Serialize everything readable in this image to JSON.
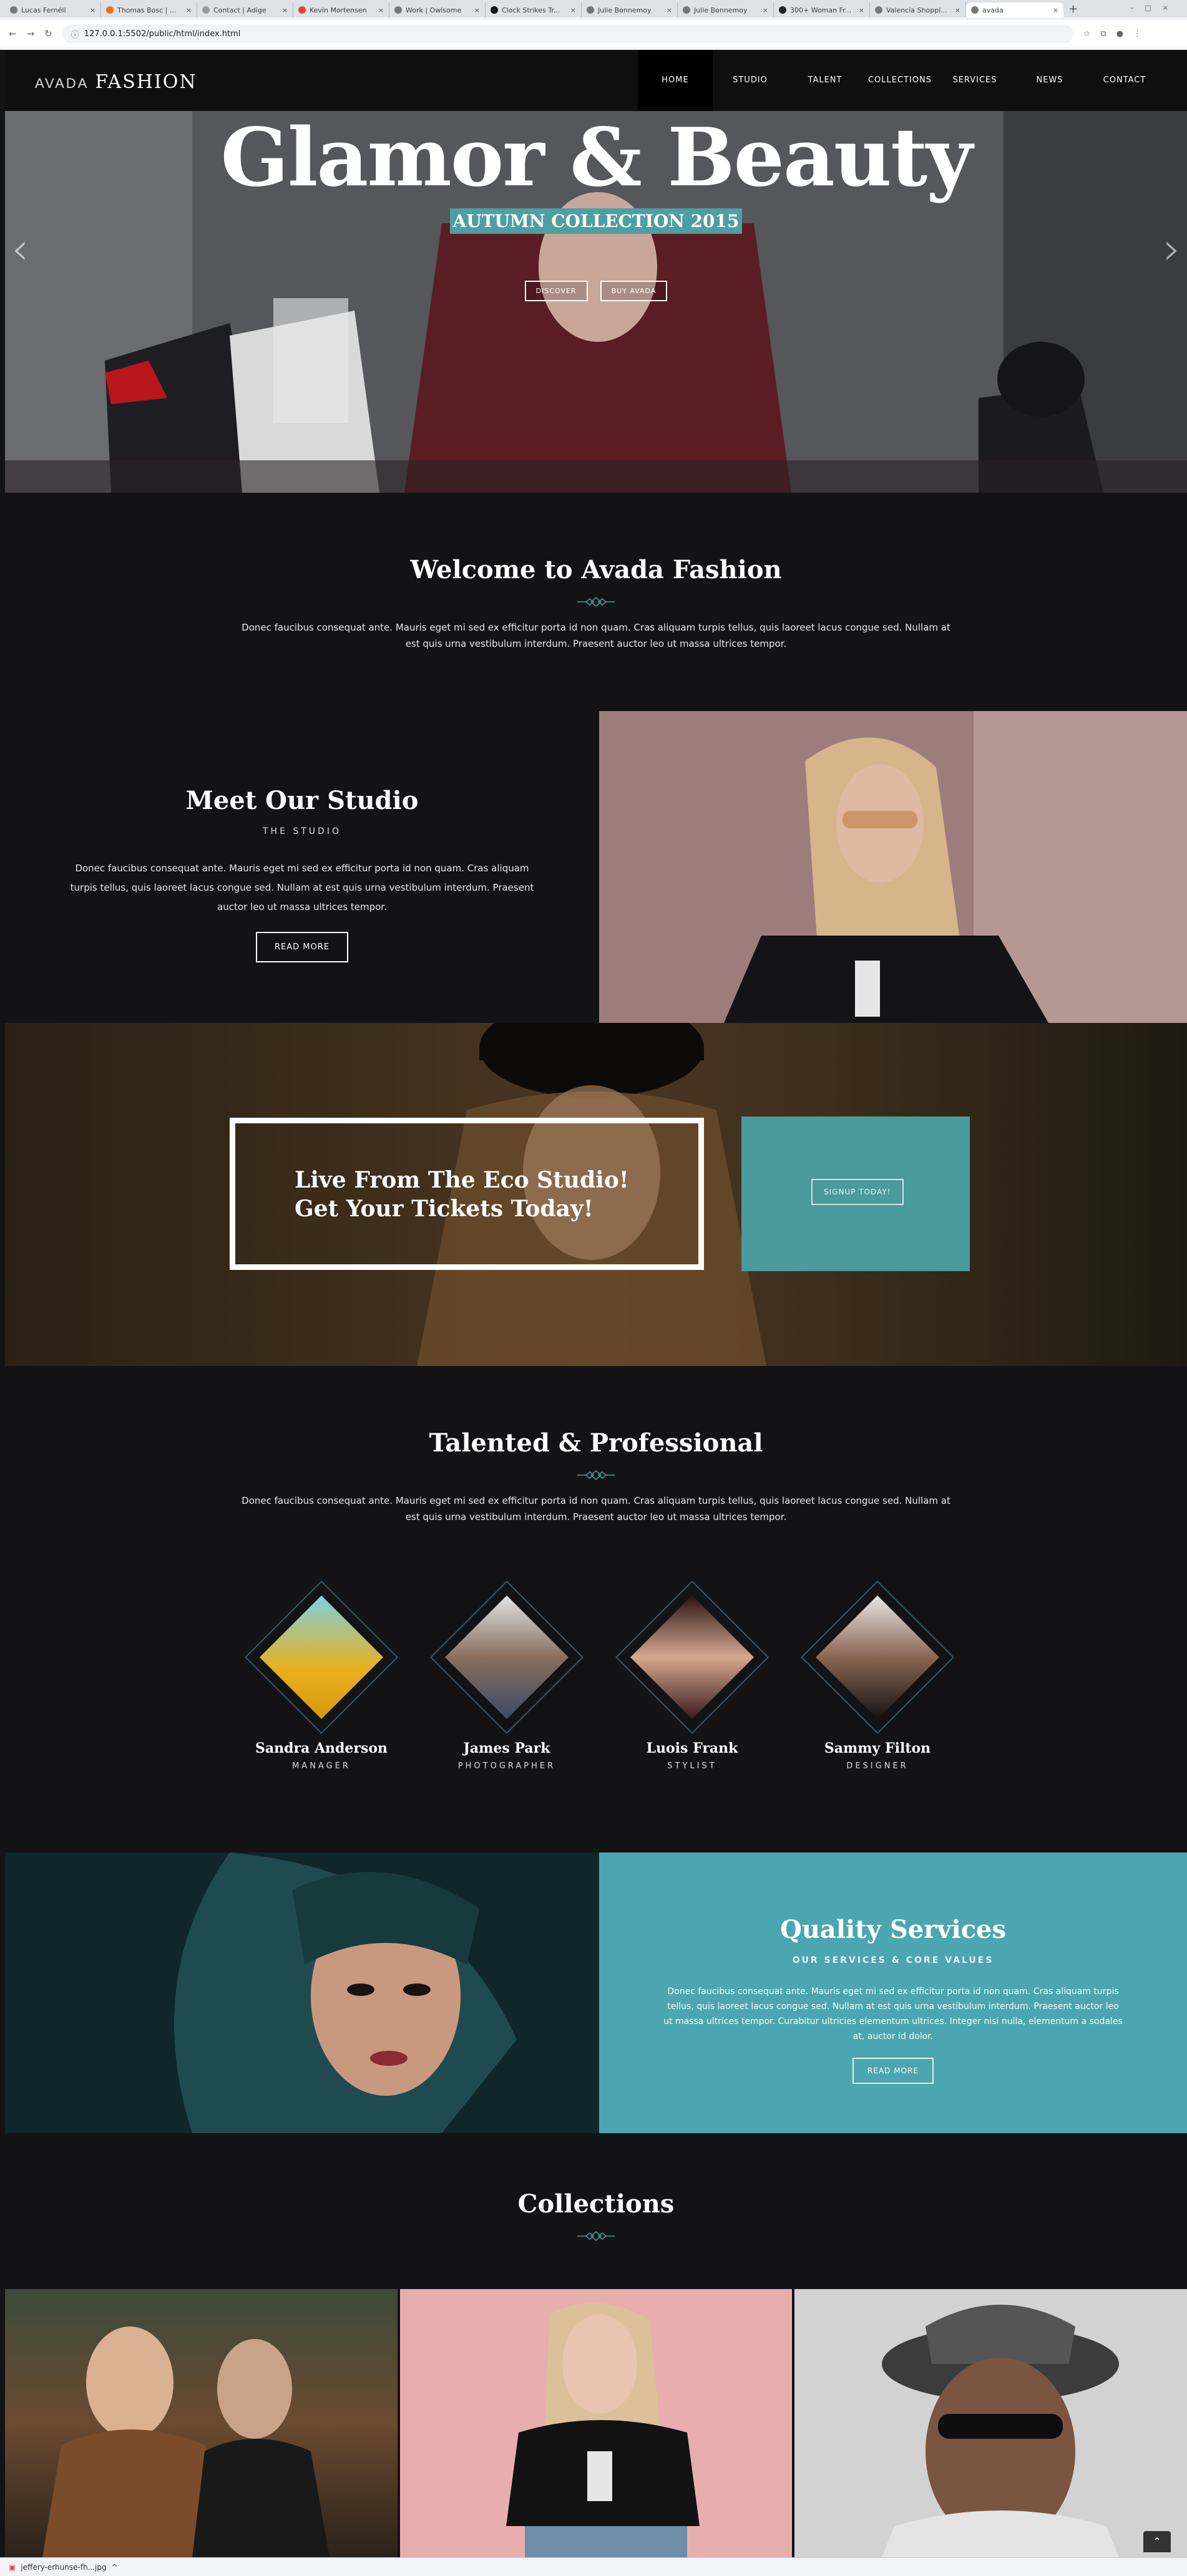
{
  "browser": {
    "tabs": [
      {
        "label": "Lucas Fernéll"
      },
      {
        "label": "Thomas Bosc | ..."
      },
      {
        "label": "Contact | Adige"
      },
      {
        "label": "Kevin Mortensen"
      },
      {
        "label": "Work | Owlsome"
      },
      {
        "label": "Clock Strikes Tr..."
      },
      {
        "label": "Julie Bonnemoy"
      },
      {
        "label": "Julie Bonnemoy"
      },
      {
        "label": "300+ Woman Fr..."
      },
      {
        "label": "Valencia Shoppi..."
      },
      {
        "label": "avada"
      }
    ],
    "url": "127.0.0.1:5502/public/html/index.html",
    "download_file": "jeffery-erhunse-fh...jpg"
  },
  "site": {
    "logo": {
      "prefix": "AVADA",
      "name": "FASHION"
    },
    "menu": [
      "HOME",
      "STUDIO",
      "TALENT",
      "COLLECTIONS",
      "SERVICES",
      "NEWS",
      "CONTACT"
    ],
    "hero": {
      "title": "Glamor & Beauty",
      "subtitle": "AUTUMN COLLECTION 2015",
      "btn_discover": "DISCOVER",
      "btn_buy": "BUY AVADA"
    },
    "welcome": {
      "title": "Welcome to Avada Fashion",
      "text": "Donec faucibus consequat ante. Mauris eget mi sed ex efficitur porta id non quam. Cras aliquam turpis tellus, quis laoreet lacus congue sed. Nullam at est quis urna vestibulum interdum. Praesent auctor leo ut massa ultrices tempor."
    },
    "studio": {
      "title": "Meet Our Studio",
      "tag": "THE STUDIO",
      "text": "Donec faucibus consequat ante. Mauris eget mi sed ex efficitur porta id non quam. Cras aliquam turpis tellus, quis laoreet lacus congue sed. Nullam at est quis urna vestibulum interdum. Praesent auctor leo ut massa ultrices tempor.",
      "button": "READ MORE"
    },
    "eco": {
      "title": "Live From The Eco Studio! Get Your Tickets Today!",
      "button": "SIGNUP TODAY!"
    },
    "talent": {
      "title": "Talented & Professional",
      "text": "Donec faucibus consequat ante. Mauris eget mi sed ex efficitur porta id non quam. Cras aliquam turpis tellus, quis laoreet lacus congue sed. Nullam at est quis urna vestibulum interdum. Praesent auctor leo ut massa ultrices tempor.",
      "members": [
        {
          "name": "Sandra Anderson",
          "role": "MANAGER"
        },
        {
          "name": "James Park",
          "role": "PHOTOGRAPHER"
        },
        {
          "name": "Luois Frank",
          "role": "STYLIST"
        },
        {
          "name": "Sammy Filton",
          "role": "DESIGNER"
        }
      ]
    },
    "quality": {
      "title": "Quality Services",
      "tag": "OUR SERVICES & CORE VALUES",
      "text": "Donec faucibus consequat ante. Mauris eget mi sed ex efficitur porta id non quam. Cras aliquam turpis tellus, quis laoreet lacus congue sed. Nullam at est quis urna vestibulum interdum. Praesent auctor leo ut massa ultrices tempor. Curabitur ultricies elementum ultrices. Integer nisi nulla, elementum a sodales at, auctor id dolor.",
      "button": "READ MORE"
    },
    "collections": {
      "title": "Collections"
    }
  },
  "colors": {
    "accent": "#4b9a9c",
    "teal_panel": "#4ba6b1",
    "dark_bg": "#131315",
    "header_bg": "#0f0f10"
  },
  "icons": {
    "prev": "chevron-left-icon",
    "next": "chevron-right-icon",
    "ornament": "diamond-ornament-icon",
    "to_top": "arrow-up-icon"
  }
}
